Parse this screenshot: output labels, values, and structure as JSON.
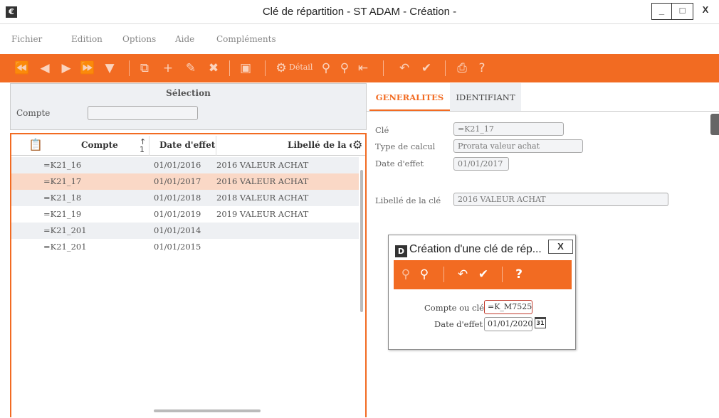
{
  "window": {
    "title": "Clé de répartition - ST ADAM - Création -",
    "app_icon": "€",
    "minimize": "_",
    "maximize": "□",
    "close": "X"
  },
  "menu": [
    "Fichier",
    "Edition",
    "Options",
    "Aide",
    "Compléments"
  ],
  "toolbar": {
    "detail_label": "Détail"
  },
  "selection": {
    "title": "Sélection",
    "compte_label": "Compte",
    "compte_value": ""
  },
  "table": {
    "headers": {
      "compte": "Compte",
      "date": "Date d'effet",
      "libelle": "Libellé de la clé"
    },
    "rows": [
      {
        "compte": "=K21_16",
        "date": "01/01/2016",
        "libelle": "2016 VALEUR ACHAT"
      },
      {
        "compte": "=K21_17",
        "date": "01/01/2017",
        "libelle": "2016 VALEUR ACHAT"
      },
      {
        "compte": "=K21_18",
        "date": "01/01/2018",
        "libelle": "2018 VALEUR ACHAT"
      },
      {
        "compte": "=K21_19",
        "date": "01/01/2019",
        "libelle": "2019 VALEUR ACHAT"
      },
      {
        "compte": "=K21_201",
        "date": "01/01/2014",
        "libelle": ""
      },
      {
        "compte": "=K21_201",
        "date": "01/01/2015",
        "libelle": ""
      }
    ]
  },
  "tabs": [
    "GENERALITES",
    "IDENTIFIANT"
  ],
  "details": {
    "cle_label": "Clé",
    "cle_value": "=K21_17",
    "type_label": "Type de calcul",
    "type_value": "Prorata valeur achat",
    "date_label": "Date d'effet",
    "date_value": "01/01/2017",
    "libelle_label": "Libellé de la clé",
    "libelle_value": "2016 VALEUR ACHAT"
  },
  "dialog": {
    "icon": "D",
    "title": "Création d'une clé de rép...",
    "close": "X",
    "compte_label": "Compte ou clé",
    "compte_value": "=K_M7525",
    "date_label": "Date d'effet",
    "date_value": "01/01/2020",
    "calendar_day": "31"
  },
  "colors": {
    "accent": "#f26b22",
    "selected_row": "#fad8c6"
  }
}
